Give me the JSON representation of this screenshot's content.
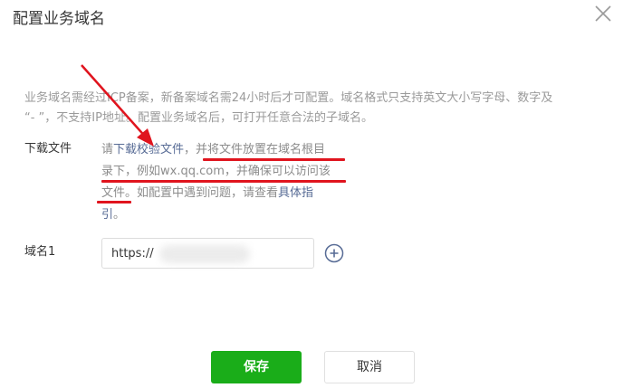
{
  "dialog": {
    "title": "配置业务域名",
    "description_line1": "业务域名需经过ICP备案，新备案域名需24小时后才可配置。域名格式只支持英文大小写字母、数字及",
    "description_line2": "“- ”，不支持IP地址。配置业务域名后，可打开任意合法的子域名。"
  },
  "download": {
    "label": "下载文件",
    "line1_prefix": "请",
    "line1_link": "下载校验文件",
    "line1_suffix": "，并将文件放置在域名根目",
    "line2": "录下，例如wx.qq.com，并确保可以访问该",
    "line3_prefix": "文件。如配置中遇到问题，请查看",
    "line3_link": "具体指",
    "line4_link": "引",
    "line4_suffix": "。"
  },
  "domain_field": {
    "label": "域名1",
    "prefix": "https://",
    "value": ""
  },
  "buttons": {
    "save": "保存",
    "cancel": "取消"
  },
  "colors": {
    "primary": "#1aad19",
    "link": "#576b95",
    "annotation": "#e0141e"
  }
}
